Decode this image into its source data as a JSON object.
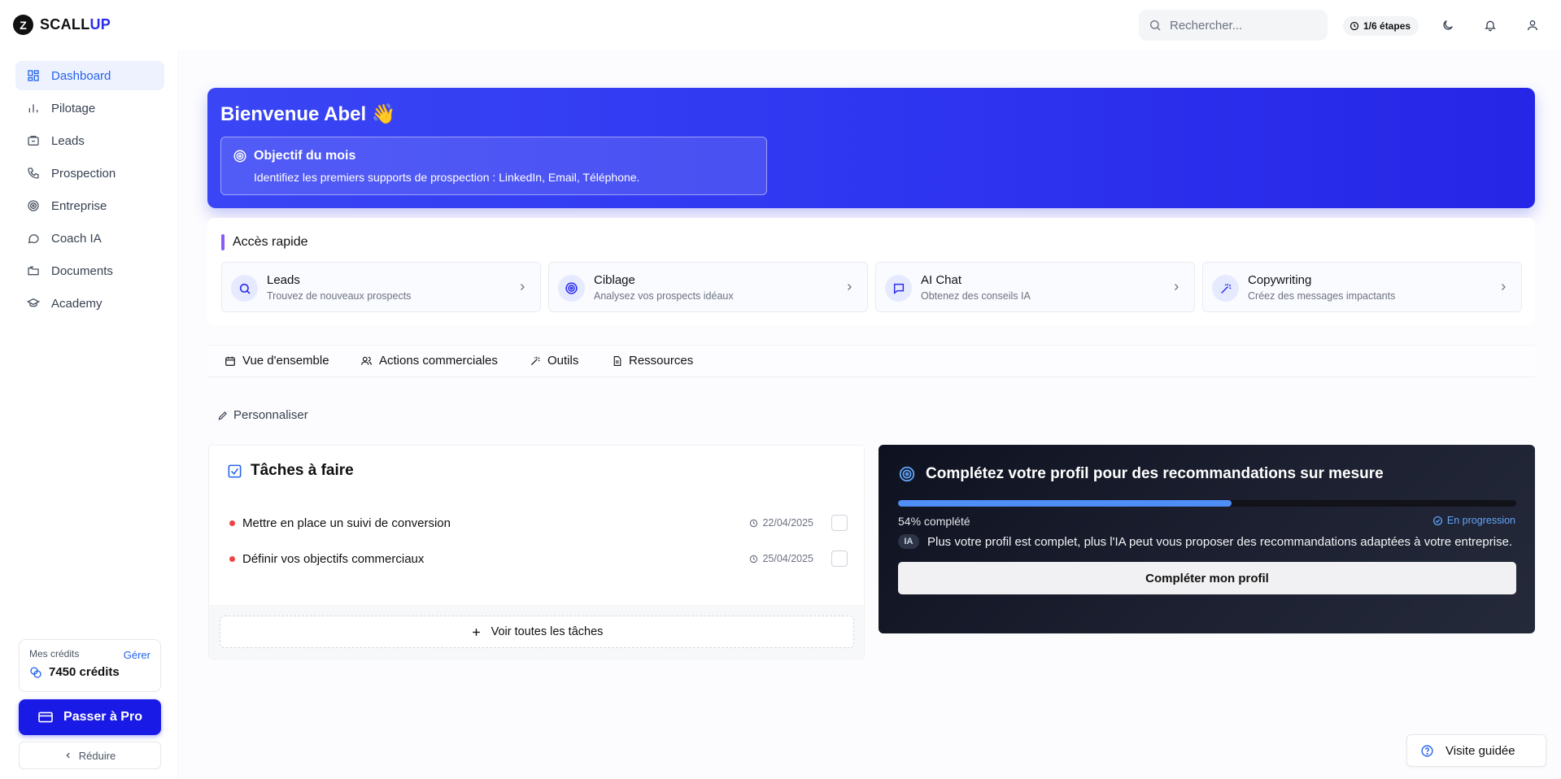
{
  "brand": {
    "name_part1": "SCALL",
    "name_part2": "UP",
    "logo_glyph": "Z"
  },
  "header": {
    "search_placeholder": "Rechercher...",
    "steps_label": "1/6 étapes"
  },
  "sidebar": {
    "items": [
      {
        "label": "Dashboard",
        "icon": "dashboard-icon",
        "active": true
      },
      {
        "label": "Pilotage",
        "icon": "bar-chart-icon"
      },
      {
        "label": "Leads",
        "icon": "leads-icon"
      },
      {
        "label": "Prospection",
        "icon": "phone-icon"
      },
      {
        "label": "Entreprise",
        "icon": "target-icon"
      },
      {
        "label": "Coach IA",
        "icon": "chat-icon"
      },
      {
        "label": "Documents",
        "icon": "folder-icon"
      },
      {
        "label": "Academy",
        "icon": "graduation-icon"
      }
    ],
    "credits": {
      "label": "Mes crédits",
      "manage": "Gérer",
      "value": "7450 crédits"
    },
    "pro_button": "Passer à Pro",
    "reduce_button": "Réduire"
  },
  "hero": {
    "title": "Bienvenue Abel 👋",
    "objective_title": "Objectif du mois",
    "objective_text": "Identifiez les premiers supports de prospection : LinkedIn, Email, Téléphone."
  },
  "quick_access": {
    "title": "Accès rapide",
    "cards": [
      {
        "title": "Leads",
        "desc": "Trouvez de nouveaux prospects",
        "icon": "search-icon"
      },
      {
        "title": "Ciblage",
        "desc": "Analysez vos prospects idéaux",
        "icon": "target-icon"
      },
      {
        "title": "AI Chat",
        "desc": "Obtenez des conseils IA",
        "icon": "message-icon"
      },
      {
        "title": "Copywriting",
        "desc": "Créez des messages impactants",
        "icon": "magic-wand-icon"
      }
    ]
  },
  "tabs": [
    {
      "label": "Vue d'ensemble",
      "icon": "calendar-icon"
    },
    {
      "label": "Actions commerciales",
      "icon": "users-icon"
    },
    {
      "label": "Outils",
      "icon": "wand-icon"
    },
    {
      "label": "Ressources",
      "icon": "document-icon"
    }
  ],
  "personalize_label": "Personnaliser",
  "tasks": {
    "title": "Tâches à faire",
    "items": [
      {
        "label": "Mettre en place un suivi de conversion",
        "date": "22/04/2025"
      },
      {
        "label": "Définir vos objectifs commerciaux",
        "date": "25/04/2025"
      }
    ],
    "see_all": "Voir toutes les tâches"
  },
  "profile": {
    "title": "Complétez votre profil pour des recommandations sur mesure",
    "progress_percent": 54,
    "progress_label": "54% complété",
    "status": "En progression",
    "ia_badge": "IA",
    "ia_text": "Plus votre profil est complet, plus l'IA peut vous proposer des recommandations adaptées à votre entreprise.",
    "button": "Compléter mon profil"
  },
  "guided_tour": "Visite guidée",
  "colors": {
    "accent": "#2b2bf0",
    "active_nav": "#2563eb",
    "task_dot": "#ef4444",
    "progress": "#4f8ef7",
    "quick_bar": "#8b5cf6"
  }
}
